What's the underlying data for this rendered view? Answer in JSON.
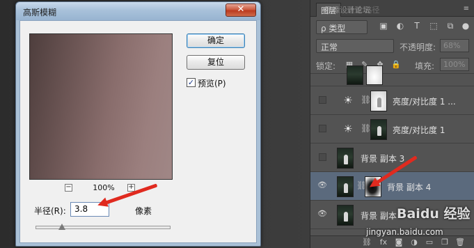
{
  "dialog": {
    "title": "高斯模糊",
    "close_label": "✕",
    "ok_label": "确定",
    "reset_label": "复位",
    "preview_label": "预览(P)",
    "preview_checked": "✓",
    "zoom_out": "−",
    "zoom_in": "+",
    "zoom_level": "100%",
    "radius_label": "半径(R):",
    "radius_value": "3.8",
    "radius_unit": "像素"
  },
  "layers_panel": {
    "tab_label": "图层",
    "tab_faded": "通道 路径",
    "filter_kind": "ρ 类型",
    "blend_mode": "正常",
    "opacity_label": "不透明度:",
    "opacity_value": "68%",
    "lock_label": "锁定:",
    "fill_label": "填充:",
    "fill_value": "100%",
    "layers": [
      {
        "name": "亮度/对比度 1 ...",
        "type": "adjustment"
      },
      {
        "name": "亮度/对比度 1",
        "type": "adjustment"
      },
      {
        "name": "背景 副本 3",
        "type": "photo"
      },
      {
        "name": "背景 副本 4",
        "type": "photo-mask",
        "selected": true
      },
      {
        "name": "背景 副本",
        "type": "photo"
      }
    ]
  },
  "watermark": {
    "top_text": "思缘设计论坛",
    "logo": "Baidu 经验",
    "url": "jingyan.baidu.com"
  },
  "colors": {
    "annotation_arrow": "#e02a1f",
    "selected_layer": "#5b6a7d",
    "dialog_chrome": "#a9c0d6"
  }
}
